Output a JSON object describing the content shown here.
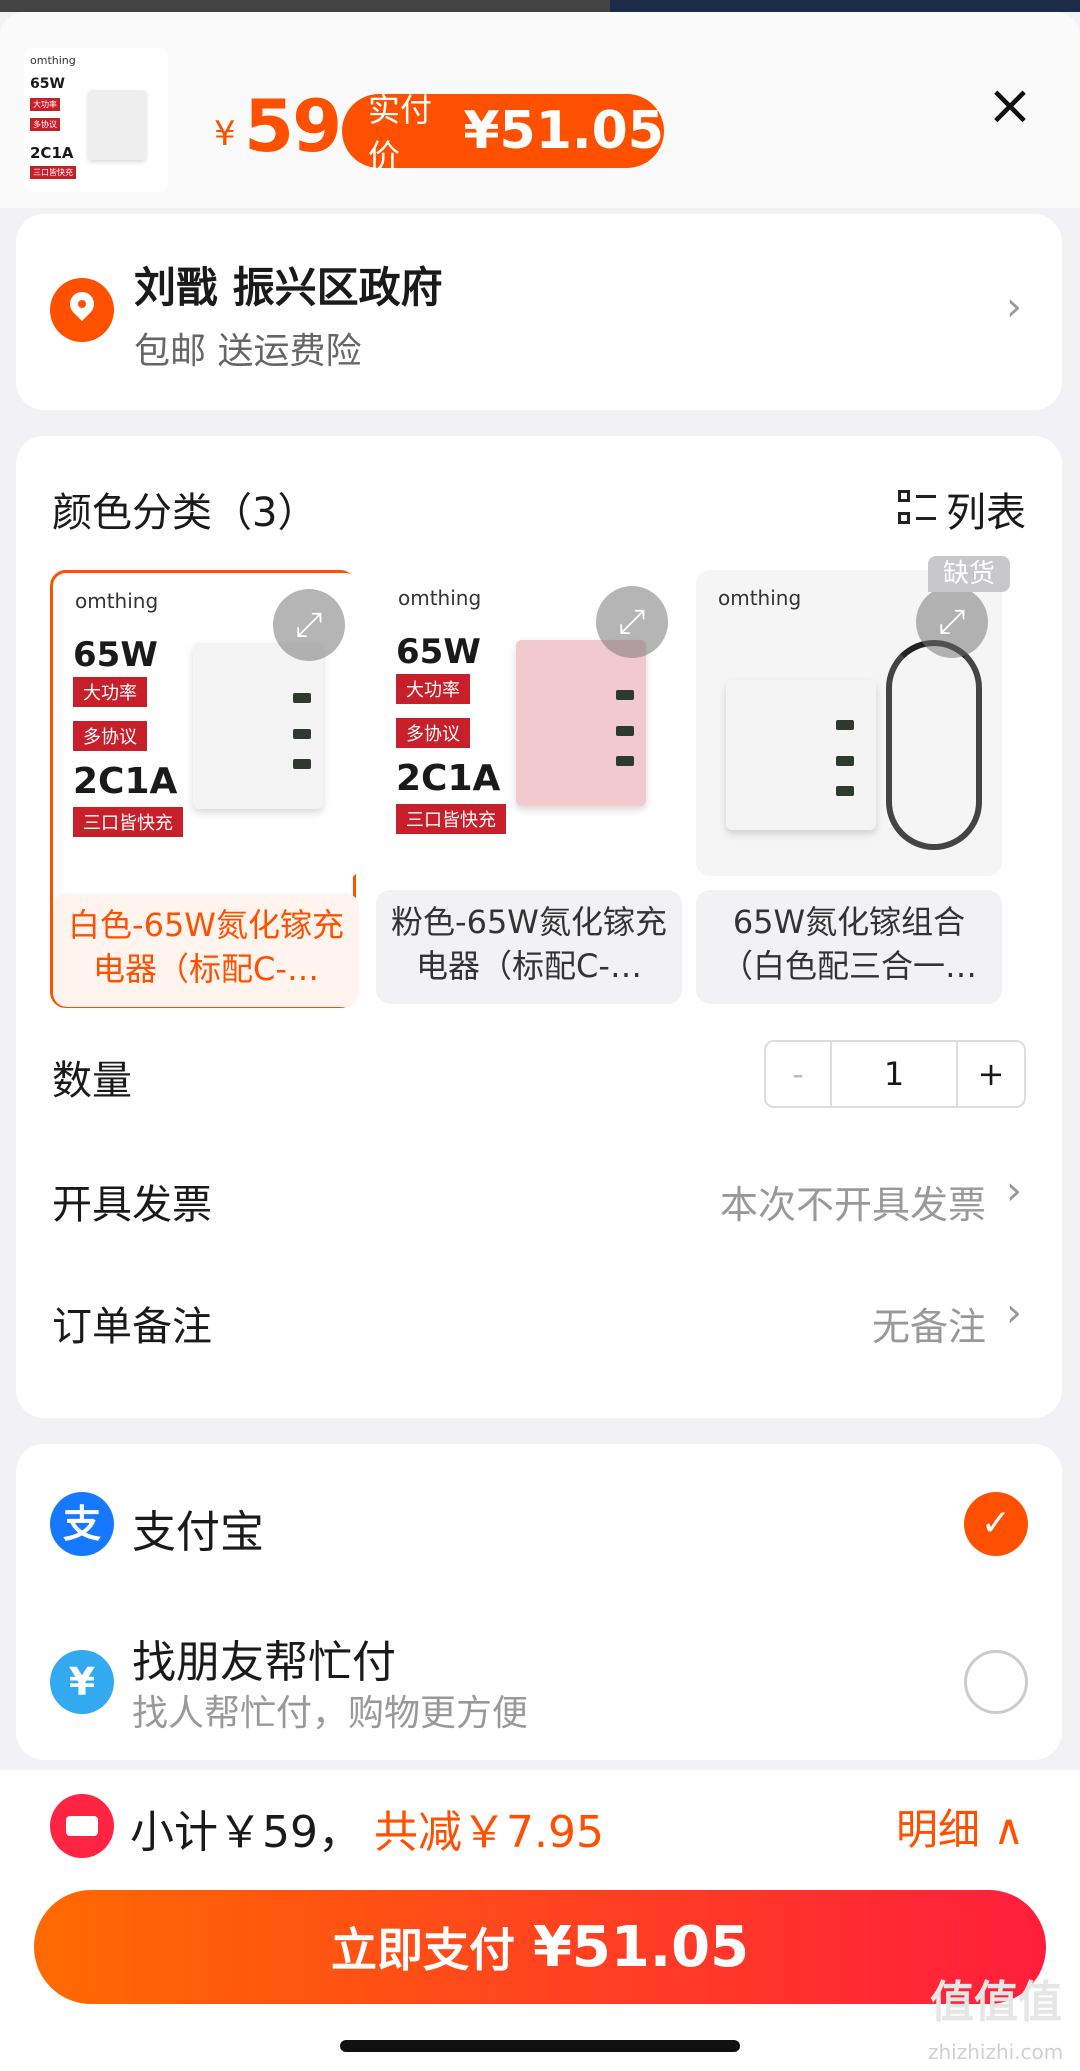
{
  "header": {
    "thumb": {
      "brand": "omthing",
      "power": "65W",
      "tag1": "大功率",
      "tag2": "多协议",
      "ports": "2C1A",
      "tag3": "三口皆快充"
    },
    "currency": "¥",
    "price": "59",
    "paid_label": "实付价",
    "paid_value": "¥51.05",
    "close_icon": "×"
  },
  "address": {
    "name": "刘戬 振兴区政府",
    "sub": "包邮  送运费险"
  },
  "options": {
    "title": "颜色分类（3）",
    "list_label": "列表",
    "skus": [
      {
        "brand": "omthing",
        "power": "65W",
        "tag1": "大功率",
        "tag2": "多协议",
        "ports": "2C1A",
        "tag3": "三口皆快充",
        "label": "白色-65W氮化镓充电器（标配C-…",
        "color": "#f4f4f4"
      },
      {
        "brand": "omthing",
        "power": "65W",
        "tag1": "大功率",
        "tag2": "多协议",
        "ports": "2C1A",
        "tag3": "三口皆快充",
        "label": "粉色-65W氮化镓充电器（标配C-…",
        "color": "#f2c9cf"
      },
      {
        "brand": "omthing",
        "label": "65W氮化镓组合（白色配三合一…",
        "color": "#f4f4f4",
        "badge": "缺货"
      }
    ],
    "quantity_label": "数量",
    "quantity": "1",
    "minus": "-",
    "plus": "+",
    "invoice_label": "开具发票",
    "invoice_value": "本次不开具发票",
    "note_label": "订单备注",
    "note_value": "无备注"
  },
  "payment": {
    "alipay_name": "支付宝",
    "alipay_icon": "支",
    "friend_name": "找朋友帮忙付",
    "friend_sub": "找人帮忙付，购物更方便",
    "friend_icon": "¥"
  },
  "footer": {
    "subtotal": "小计￥59，",
    "discount": "共减￥7.95",
    "detail": "明细 ∧",
    "pay_label": "立即支付",
    "pay_value": "¥51.05",
    "watermark": "值值值",
    "watermark_url": "zhizhizhi.com"
  },
  "colors": {
    "accent": "#ff5000",
    "pay_gradient_end": "#ff1e3c",
    "alipay": "#1677ff"
  }
}
